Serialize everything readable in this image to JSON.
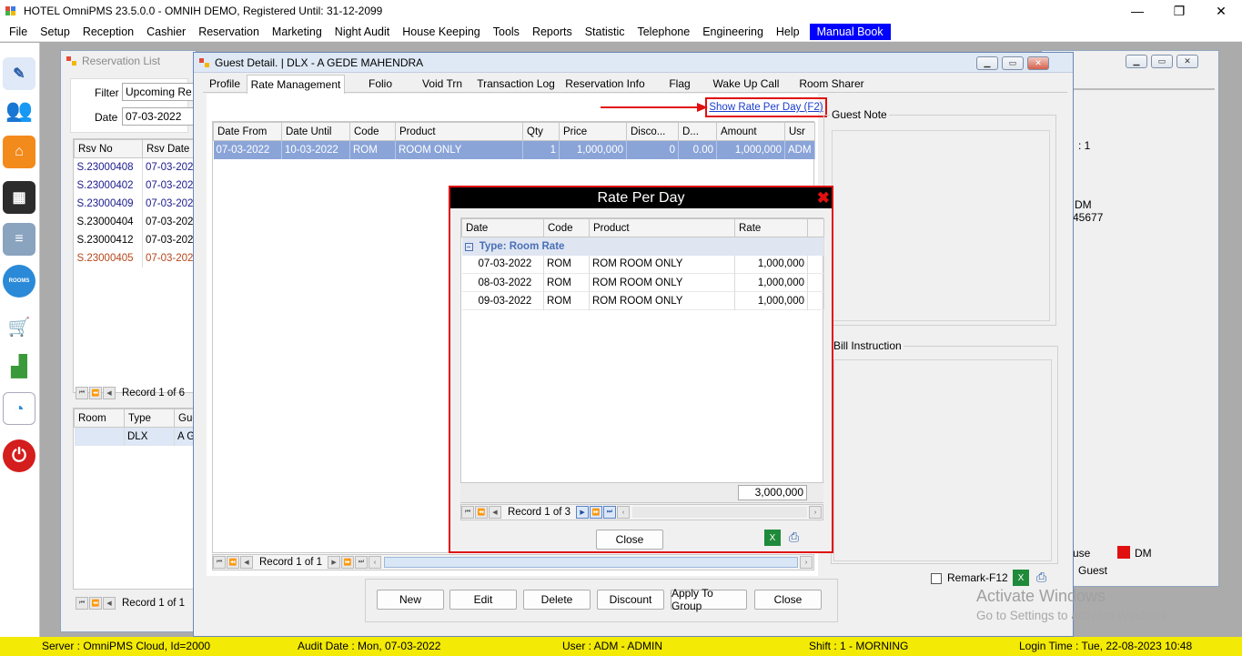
{
  "title_bar": {
    "title": "HOTEL OmniPMS 23.5.0.0 - OMNIH DEMO, Registered Until: 31-12-2099",
    "minimize": "—",
    "maximize": "❐",
    "close": "✕"
  },
  "menu": [
    "File",
    "Setup",
    "Reception",
    "Cashier",
    "Reservation",
    "Marketing",
    "Night Audit",
    "House Keeping",
    "Tools",
    "Reports",
    "Statistic",
    "Telephone",
    "Engineering",
    "Help"
  ],
  "menu_highlight": "Manual Book",
  "reservation_list": {
    "title": "Reservation List",
    "filter_label": "Filter",
    "filter_value": "Upcoming Re",
    "date_label": "Date",
    "date_value": "07-03-2022",
    "columns": [
      "Rsv No",
      "Rsv Date"
    ],
    "rows": [
      {
        "no": "S.23000408",
        "date": "07-03-2022",
        "color": "#1a1a8c"
      },
      {
        "no": "S.23000402",
        "date": "07-03-2022",
        "color": "#1a1a8c"
      },
      {
        "no": "S.23000409",
        "date": "07-03-2022",
        "color": "#1a1a8c"
      },
      {
        "no": "S.23000404",
        "date": "07-03-2022",
        "color": "#000000"
      },
      {
        "no": "S.23000412",
        "date": "07-03-2022",
        "color": "#000000"
      },
      {
        "no": "S.23000405",
        "date": "07-03-2022",
        "color": "#b5461a"
      }
    ],
    "record_text": "Record 1 of 6",
    "room_columns": [
      "Room",
      "Type",
      "Gue"
    ],
    "room_row": [
      "",
      "DLX",
      "A GE"
    ],
    "room_record": "Record 1 of 1"
  },
  "guest_detail": {
    "title": "Guest Detail. | DLX - A GEDE MAHENDRA",
    "tabs": [
      "Profile",
      "Rate Management",
      "Folio",
      "Void Trn",
      "Transaction Log",
      "Reservation Info",
      "Flag",
      "Wake Up Call",
      "Room Sharer"
    ],
    "active_tab": "Rate Management",
    "show_rate_link": "Show Rate Per Day (F2)",
    "guest_note_label": "Guest Note",
    "bill_instruction_label": "Bill Instruction",
    "rate_columns": [
      "Date From",
      "Date Until",
      "Code",
      "Product",
      "Qty",
      "Price",
      "Disco...",
      "D...",
      "Amount",
      "Usr"
    ],
    "rate_row": [
      "07-03-2022",
      "10-03-2022",
      "ROM",
      "ROOM ONLY",
      "1",
      "1,000,000",
      "0",
      "0.00",
      "1,000,000",
      "ADM"
    ],
    "record_text": "Record 1 of 1",
    "buttons": [
      "New",
      "Edit",
      "Delete",
      "Discount",
      "Apply To Group",
      "Close"
    ],
    "remark_label": "Remark-F12"
  },
  "rate_per_day": {
    "title": "Rate Per Day",
    "columns": [
      "Date",
      "Code",
      "Product",
      "Rate"
    ],
    "group_label": "Type:  Room Rate",
    "rows": [
      [
        "07-03-2022",
        "ROM",
        "ROM ROOM ONLY",
        "1,000,000"
      ],
      [
        "08-03-2022",
        "ROM",
        "ROM ROOM ONLY",
        "1,000,000"
      ],
      [
        "09-03-2022",
        "ROM",
        "ROM ROOM ONLY",
        "1,000,000"
      ]
    ],
    "total": "3,000,000",
    "record_text": "Record 1 of 3",
    "close_button": "Close"
  },
  "right_panel": {
    "line1": ": 1",
    "line2": "DM",
    "line3": "45677",
    "legend1": "use",
    "legend2": "DM",
    "legend3": "Guest"
  },
  "watermark": {
    "line1": "Activate Windows",
    "line2": "Go to Settings to activate Windows."
  },
  "status_bar": {
    "server": "Server : OmniPMS Cloud, Id=2000",
    "audit": "Audit Date : Mon, 07-03-2022",
    "user": "User : ADM - ADMIN",
    "shift": "Shift : 1 - MORNING",
    "login": "Login Time : Tue, 22-08-2023 10:48"
  },
  "colors": {
    "highlight_red": "#e01010",
    "status_yellow": "#f3ea05",
    "selected_row": "#8aa4d8"
  }
}
